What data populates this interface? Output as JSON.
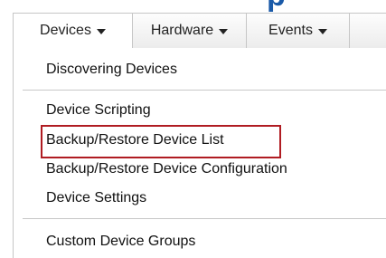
{
  "heading": {
    "fragment": "p"
  },
  "menubar": {
    "tabs": [
      {
        "label": "Devices"
      },
      {
        "label": "Hardware"
      },
      {
        "label": "Events"
      },
      {
        "label": ""
      }
    ]
  },
  "dropdown": {
    "items": [
      {
        "label": "Discovering Devices"
      },
      {
        "label": "Device Scripting"
      },
      {
        "label": "Backup/Restore Device List"
      },
      {
        "label": "Backup/Restore Device Configuration"
      },
      {
        "label": "Device Settings"
      },
      {
        "label": "Custom Device Groups"
      }
    ],
    "highlighted_item": "Backup/Restore Device List"
  },
  "colors": {
    "heading": "#1a5aa8",
    "highlight_border": "#b01c22",
    "menubar_border": "#c6c6c6"
  }
}
